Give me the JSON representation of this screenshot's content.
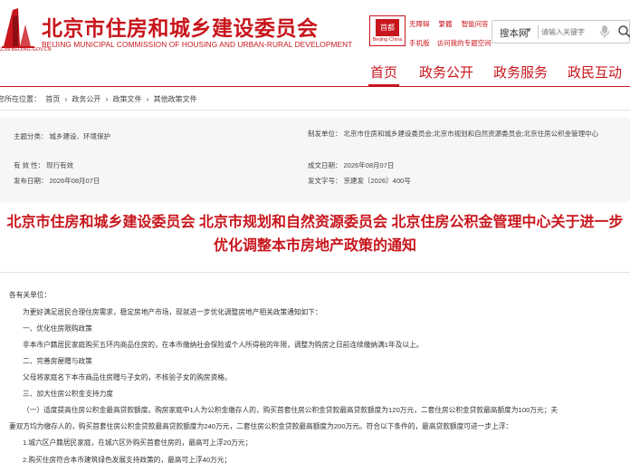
{
  "header": {
    "org_name": "北京市住房和城乡建设委员会",
    "org_name_en": "BEIJING MUNICIPAL COMMISSION OF HOUSING AND URBAN-RURAL DEVELOPMENT",
    "site_url": "ZJW.BEIJING.GOV.CN",
    "badge_gate": "首都",
    "badge_caption": "Beijing·China",
    "links_row1": [
      "无障碍",
      "繁體",
      "智能问答"
    ],
    "links_row2": [
      "手机版",
      "访问我的专题空间"
    ],
    "search": {
      "scope": "搜本网",
      "placeholder": "请输入关键字"
    }
  },
  "nav": {
    "items": [
      "首页",
      "政务公开",
      "政务服务",
      "政民互动"
    ],
    "active_index": 0
  },
  "breadcrumb": {
    "prefix": "您所在位置：",
    "items": [
      "首页",
      "政务公开",
      "政策文件",
      "其他政策文件"
    ],
    "separator": "›"
  },
  "meta": {
    "topic_label": "主题分类：",
    "topic_value": "城乡建设、环境保护",
    "issuer_label": "制发单位：",
    "issuer_value": "北京市住房和城乡建设委员会;北京市规划和自然资源委员会;北京住房公积金管理中心",
    "validity_label": "有 效 性：",
    "validity_value": "现行有效",
    "created_label": "成文日期：",
    "created_value": "2026年08月07日",
    "published_label": "发布日期：",
    "published_value": "2026年08月07日",
    "docno_label": "发文字号：",
    "docno_value": "京建发〔2026〕400号"
  },
  "title": {
    "line1": "北京市住房和城乡建设委员会 北京市规划和自然资源委员会 北京住房公积金管理中心关于进一步",
    "line2": "优化调整本市房地产政策的通知"
  },
  "body": {
    "salutation": "各有关单位：",
    "paragraphs": [
      "为更好满足居民合理住房需求，稳定房地产市场，现就进一步优化调整房地产相关政策通知如下：",
      "一、优化住房限购政策",
      "非本市户籍居民家庭购买五环内商品住房的，在本市缴纳社会保险或个人所得税的年限，调整为购房之日前连续缴纳满1年及以上。",
      "二、完善房屋赠与政策",
      "父母将家庭名下本市商品住房赠与子女的，不核验子女的购房资格。",
      "三、加大住房公积金支持力度",
      "（一）适度提高住房公积金最高贷款额度。购房家庭中1人为公积金缴存人的，购买首套住房公积金贷款最高贷款额度为120万元，二套住房公积金贷款最高额度为100万元；夫",
      "妻双方均为缴存人的，购买首套住房公积金贷款最高贷款额度为240万元，二套住房公积金贷款最高额度为200万元。符合以下条件的，最高贷款额度可进一步上浮：",
      "1.城六区户籍居民家庭，在城六区外购买首套住房的，最高可上浮20万元；",
      "2.购买住房符合本市建筑绿色发展支持政策的，最高可上浮40万元；"
    ]
  },
  "colors": {
    "brand_red": "#c8161d",
    "meta_bg": "#f6f6f6"
  }
}
